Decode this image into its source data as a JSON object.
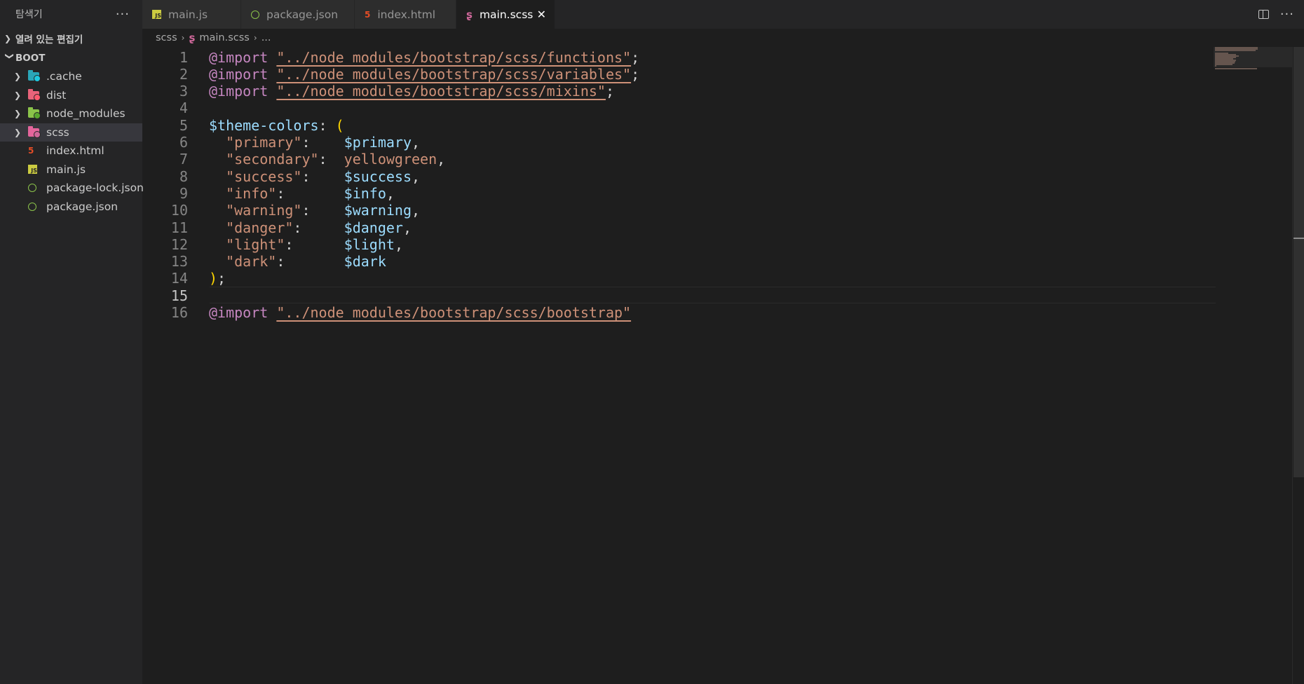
{
  "sidebar": {
    "title": "탐색기",
    "more_icon": "···",
    "open_editors_label": "열려 있는 편집기",
    "root_label": "BOOT",
    "items": [
      {
        "name": ".cache",
        "type": "folder",
        "color": "#2aa6b8",
        "badge": "#1fc9e0"
      },
      {
        "name": "dist",
        "type": "folder",
        "color": "#e8637a",
        "badge": "#ff5a6f"
      },
      {
        "name": "node_modules",
        "type": "folder",
        "color": "#8bc34a",
        "badge": "#5aa72e"
      },
      {
        "name": "scss",
        "type": "folder",
        "color": "#e4659c",
        "badge": "#cd6799",
        "selected": true
      },
      {
        "name": "index.html",
        "type": "html"
      },
      {
        "name": "main.js",
        "type": "js",
        "glyph": "JS"
      },
      {
        "name": "package-lock.json",
        "type": "json"
      },
      {
        "name": "package.json",
        "type": "json"
      }
    ]
  },
  "tabs": [
    {
      "label": "main.js",
      "icon": "js-icon",
      "glyph": "JS",
      "width": 141
    },
    {
      "label": "package.json",
      "icon": "npm-json-icon",
      "width": 162
    },
    {
      "label": "index.html",
      "icon": "html5-icon",
      "glyph": "5",
      "width": 145
    },
    {
      "label": "main.scss",
      "icon": "sass-icon",
      "glyph": "ʂ",
      "width": 141,
      "active": true,
      "close": "✕"
    }
  ],
  "breadcrumb": {
    "folder": "scss",
    "file": "main.scss",
    "rest": "...",
    "sep": "›"
  },
  "editor": {
    "current_line": 15,
    "lines": [
      {
        "n": "1",
        "tokens": [
          [
            "kw",
            "@import"
          ],
          [
            "plain",
            " "
          ],
          [
            "str",
            "\"../node_modules/bootstrap/scss/functions\""
          ],
          [
            "plain",
            ";"
          ]
        ]
      },
      {
        "n": "2",
        "tokens": [
          [
            "kw",
            "@import"
          ],
          [
            "plain",
            " "
          ],
          [
            "str",
            "\"../node_modules/bootstrap/scss/variables\""
          ],
          [
            "plain",
            ";"
          ]
        ]
      },
      {
        "n": "3",
        "tokens": [
          [
            "kw",
            "@import"
          ],
          [
            "plain",
            " "
          ],
          [
            "str",
            "\"../node_modules/bootstrap/scss/mixins\""
          ],
          [
            "plain",
            ";"
          ]
        ]
      },
      {
        "n": "4",
        "tokens": []
      },
      {
        "n": "5",
        "tokens": [
          [
            "var",
            "$theme-colors"
          ],
          [
            "plain",
            ": "
          ],
          [
            "paren",
            "("
          ]
        ]
      },
      {
        "n": "6",
        "tokens": [
          [
            "plain",
            "  "
          ],
          [
            "strp",
            "\"primary\""
          ],
          [
            "plain",
            ":    "
          ],
          [
            "var",
            "$primary"
          ],
          [
            "plain",
            ","
          ]
        ]
      },
      {
        "n": "7",
        "tokens": [
          [
            "plain",
            "  "
          ],
          [
            "strp",
            "\"secondary\""
          ],
          [
            "plain",
            ":  "
          ],
          [
            "strp",
            "yellowgreen"
          ],
          [
            "plain",
            ","
          ]
        ]
      },
      {
        "n": "8",
        "tokens": [
          [
            "plain",
            "  "
          ],
          [
            "strp",
            "\"success\""
          ],
          [
            "plain",
            ":    "
          ],
          [
            "var",
            "$success"
          ],
          [
            "plain",
            ","
          ]
        ]
      },
      {
        "n": "9",
        "tokens": [
          [
            "plain",
            "  "
          ],
          [
            "strp",
            "\"info\""
          ],
          [
            "plain",
            ":       "
          ],
          [
            "var",
            "$info"
          ],
          [
            "plain",
            ","
          ]
        ]
      },
      {
        "n": "10",
        "tokens": [
          [
            "plain",
            "  "
          ],
          [
            "strp",
            "\"warning\""
          ],
          [
            "plain",
            ":    "
          ],
          [
            "var",
            "$warning"
          ],
          [
            "plain",
            ","
          ]
        ]
      },
      {
        "n": "11",
        "tokens": [
          [
            "plain",
            "  "
          ],
          [
            "strp",
            "\"danger\""
          ],
          [
            "plain",
            ":     "
          ],
          [
            "var",
            "$danger"
          ],
          [
            "plain",
            ","
          ]
        ]
      },
      {
        "n": "12",
        "tokens": [
          [
            "plain",
            "  "
          ],
          [
            "strp",
            "\"light\""
          ],
          [
            "plain",
            ":      "
          ],
          [
            "var",
            "$light"
          ],
          [
            "plain",
            ","
          ]
        ]
      },
      {
        "n": "13",
        "tokens": [
          [
            "plain",
            "  "
          ],
          [
            "strp",
            "\"dark\""
          ],
          [
            "plain",
            ":       "
          ],
          [
            "var",
            "$dark"
          ]
        ]
      },
      {
        "n": "14",
        "tokens": [
          [
            "paren",
            ")"
          ],
          [
            "plain",
            ";"
          ]
        ]
      },
      {
        "n": "15",
        "tokens": []
      },
      {
        "n": "16",
        "tokens": [
          [
            "kw",
            "@import"
          ],
          [
            "plain",
            " "
          ],
          [
            "str",
            "\"../node_modules/bootstrap/scss/bootstrap\""
          ]
        ]
      }
    ]
  }
}
